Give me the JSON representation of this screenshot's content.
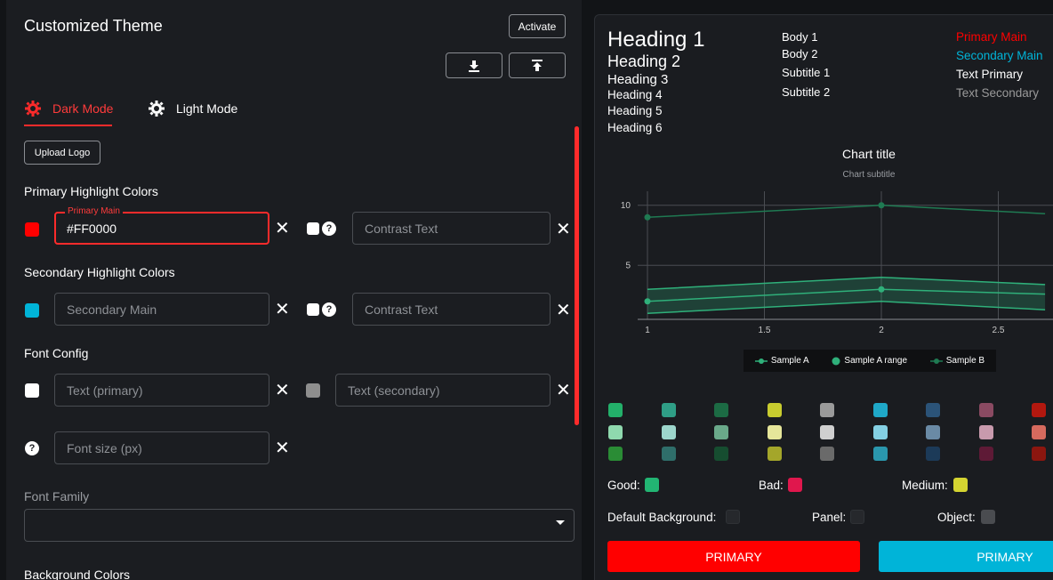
{
  "header": {
    "title": "Customized Theme",
    "activate_label": "Activate"
  },
  "tabs": [
    {
      "label": "Dark Mode",
      "active": true
    },
    {
      "label": "Light Mode",
      "active": false
    }
  ],
  "upload_logo_label": "Upload Logo",
  "primary": {
    "heading": "Primary Highlight Colors",
    "swatch_color": "#FF0000",
    "main_legend": "Primary Main",
    "main_value": "#FF0000",
    "contrast_placeholder": "Contrast Text"
  },
  "secondary": {
    "heading": "Secondary Highlight Colors",
    "swatch_color": "#00B4D8",
    "main_placeholder": "Secondary Main",
    "contrast_placeholder": "Contrast Text"
  },
  "font_config": {
    "heading": "Font Config",
    "text_primary_placeholder": "Text (primary)",
    "text_secondary_placeholder": "Text (secondary)",
    "font_size_placeholder": "Font size (px)",
    "font_family_label": "Font Family",
    "font_family_value": ""
  },
  "background": {
    "heading": "Background Colors"
  },
  "preview": {
    "headings": [
      "Heading 1",
      "Heading 2",
      "Heading 3",
      "Heading 4",
      "Heading 5",
      "Heading 6"
    ],
    "body": [
      "Body 1",
      "Body 2",
      "Subtitle 1",
      "Subtitle 2"
    ],
    "colors_text": [
      {
        "label": "Primary Main",
        "color": "#FF0000"
      },
      {
        "label": "Secondary Main",
        "color": "#00B4D8"
      },
      {
        "label": "Text Primary",
        "color": "#FFFFFF"
      },
      {
        "label": "Text Secondary",
        "color": "#9A9A9A"
      }
    ],
    "status": {
      "good_label": "Good:",
      "good_color": "#22B573",
      "bad_label": "Bad:",
      "bad_color": "#E0174D",
      "medium_label": "Medium:",
      "medium_color": "#D4D431"
    },
    "bg": {
      "default_label": "Default Background:",
      "default_color": "#1F2125",
      "panel_label": "Panel:",
      "panel_color": "#25272B",
      "object_label": "Object:",
      "object_color": "#4A4C50"
    },
    "primary_button_label": "PRIMARY",
    "secondary_button_label": "PRIMARY",
    "palette": [
      [
        "#23b06a",
        "#2f9e86",
        "#1c6b44",
        "#c8cc2f",
        "#9a9a9a",
        "#1fa8c8",
        "#2b5378",
        "#8a4a62",
        "#b3180f"
      ],
      [
        "#8fd9ae",
        "#9dd6cc",
        "#6aa98a",
        "#e6e69a",
        "#cfcfcf",
        "#84d0e3",
        "#6a8aa5",
        "#c89aad",
        "#d66a5e"
      ],
      [
        "#2a8c35",
        "#2f6e6a",
        "#164d30",
        "#a4a62a",
        "#6a6a6a",
        "#2a97ad",
        "#1c3a58",
        "#5e1a36",
        "#8c160f"
      ]
    ]
  },
  "chart_data": {
    "type": "line",
    "title": "Chart title",
    "subtitle": "Chart subtitle",
    "x_ticks": [
      "1",
      "1.5",
      "2",
      "2.5"
    ],
    "y_ticks": [
      "10",
      "5"
    ],
    "xlim": [
      1,
      2.7
    ],
    "ylim": [
      0.5,
      10.5
    ],
    "series": [
      {
        "name": "Sample A",
        "color": "#2fb07a",
        "x": [
          1,
          2,
          2.7
        ],
        "y": [
          2,
          3,
          2.6
        ]
      },
      {
        "name": "Sample A range",
        "color": "#2fb07a",
        "x": [
          1,
          2,
          2.7
        ],
        "low": [
          1,
          2,
          1.3
        ],
        "high": [
          3,
          4,
          3.4
        ]
      },
      {
        "name": "Sample B",
        "color": "#1f7a52",
        "x": [
          1,
          2,
          2.7
        ],
        "y": [
          9,
          10,
          9.3
        ]
      }
    ],
    "legend": [
      "Sample A",
      "Sample A range",
      "Sample B"
    ]
  }
}
